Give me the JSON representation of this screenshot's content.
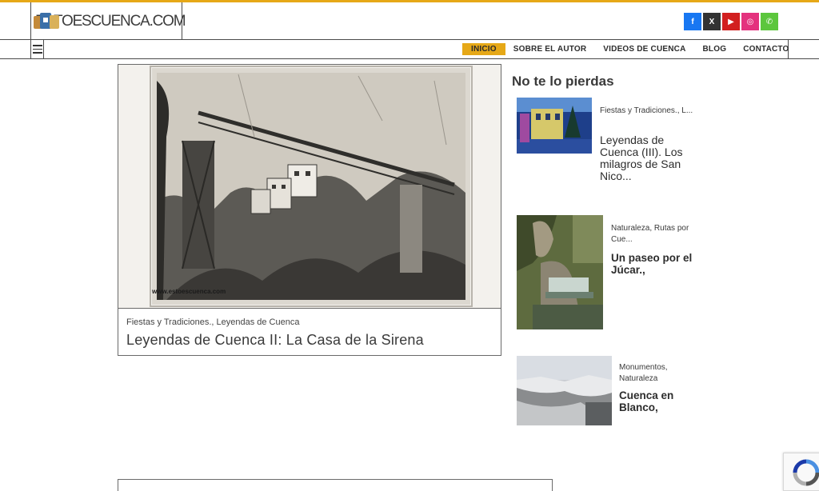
{
  "site": {
    "logo_text": "ESTOESCUENCA.COM",
    "accent": "#e6a817"
  },
  "socials": [
    {
      "icon": "facebook-icon",
      "glyph": "f",
      "color": "#1877f2"
    },
    {
      "icon": "x-icon",
      "glyph": "X",
      "color": "#333333"
    },
    {
      "icon": "youtube-icon",
      "glyph": "▶",
      "color": "#d21f1f"
    },
    {
      "icon": "instagram-icon",
      "glyph": "◎",
      "color": "#e4327e"
    },
    {
      "icon": "whatsapp-icon",
      "glyph": "✆",
      "color": "#5cc63d"
    }
  ],
  "nav": {
    "items": [
      "INICIO",
      "SOBRE EL AUTOR",
      "VIDEOS DE CUENCA",
      "BLOG",
      "CONTACTO"
    ]
  },
  "featured": {
    "watermark": "www.estoescuenca.com",
    "categories": "Fiestas y Tradiciones., Leyendas de Cuenca",
    "title": "Leyendas de Cuenca II: La Casa de la Sirena"
  },
  "sidebar": {
    "heading": "No te lo pierdas",
    "items": [
      {
        "categories": "Fiestas y Tradiciones., L...",
        "title": "Leyendas de Cuenca (III). Los milagros de San Nico..."
      },
      {
        "categories": "Naturaleza, Rutas por Cue...",
        "title": "Un paseo por el Júcar.,"
      },
      {
        "categories": "Monumentos, Naturaleza",
        "title": "Cuenca en Blanco,"
      }
    ]
  }
}
